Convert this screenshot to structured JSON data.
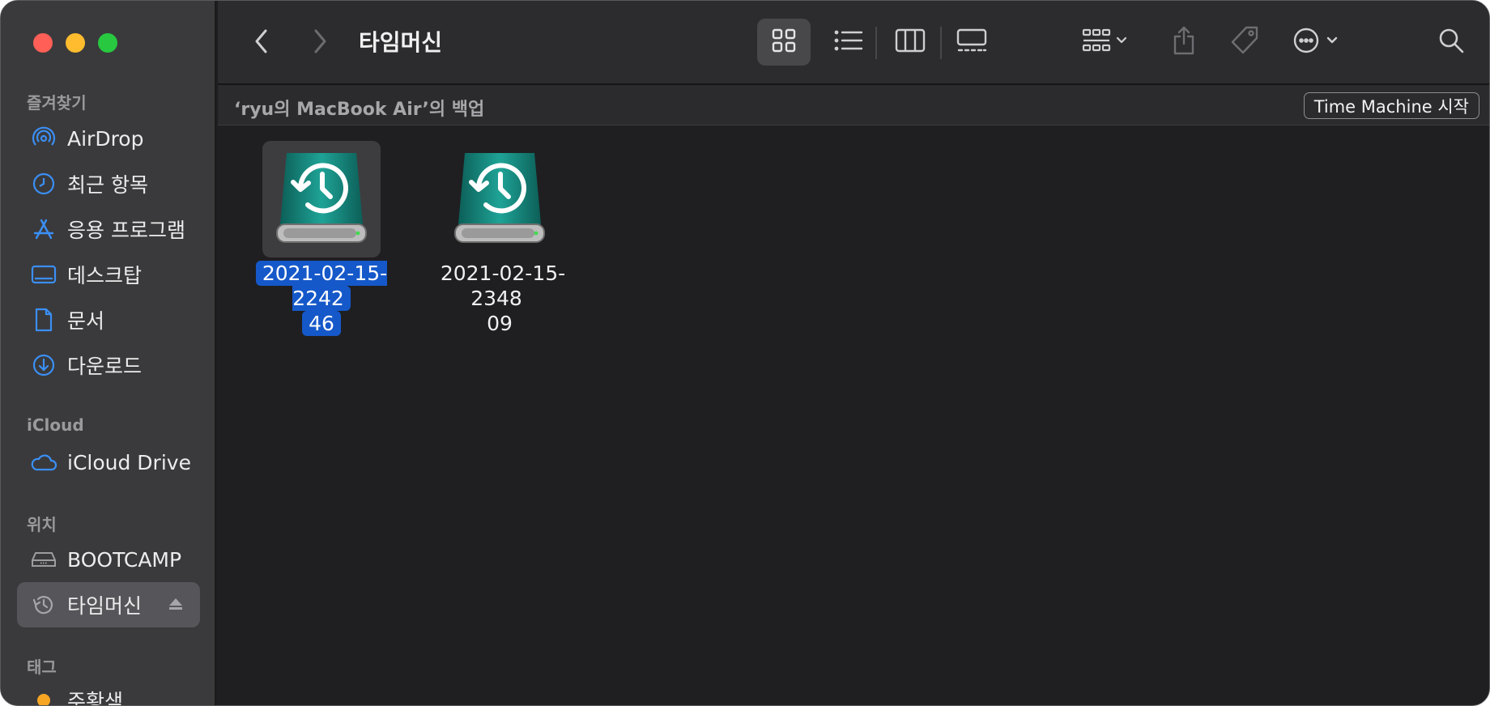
{
  "window": {
    "title": "타임머신"
  },
  "sidebar": {
    "sections": [
      {
        "title": "즐겨찾기",
        "items": [
          {
            "label": "AirDrop",
            "icon": "airdrop-icon"
          },
          {
            "label": "최근 항목",
            "icon": "clock-icon"
          },
          {
            "label": "응용 프로그램",
            "icon": "apps-icon"
          },
          {
            "label": "데스크탑",
            "icon": "desktop-icon"
          },
          {
            "label": "문서",
            "icon": "document-icon"
          },
          {
            "label": "다운로드",
            "icon": "download-icon"
          }
        ]
      },
      {
        "title": "iCloud",
        "items": [
          {
            "label": "iCloud Drive",
            "icon": "cloud-icon"
          }
        ]
      },
      {
        "title": "위치",
        "items": [
          {
            "label": "BOOTCAMP",
            "icon": "drive-icon"
          },
          {
            "label": "타임머신",
            "icon": "time-machine-icon",
            "selected": true
          }
        ]
      },
      {
        "title": "태그",
        "items": [
          {
            "label": "주황색",
            "icon": "tag-dot-icon",
            "color": "#f6a623"
          }
        ]
      }
    ]
  },
  "toolbar": {
    "title": "타임머신",
    "icons": [
      "back-icon",
      "forward-icon",
      "icon-view-icon",
      "list-view-icon",
      "column-view-icon",
      "gallery-view-icon",
      "group-icon",
      "share-icon",
      "tag-icon",
      "more-icon",
      "search-icon"
    ]
  },
  "pathbar": {
    "label": "‘ryu의 MacBook Air’의 백업",
    "button": "Time Machine 시작"
  },
  "files": [
    {
      "name_line1": "2021-02-15-2242",
      "name_line2": "46",
      "selected": true
    },
    {
      "name_line1": "2021-02-15-2348",
      "name_line2": "09",
      "selected": false
    }
  ],
  "colors": {
    "accent": "#1558c9",
    "sidebar_icon": "#3b8ff5",
    "drive_teal": "#16857c"
  }
}
